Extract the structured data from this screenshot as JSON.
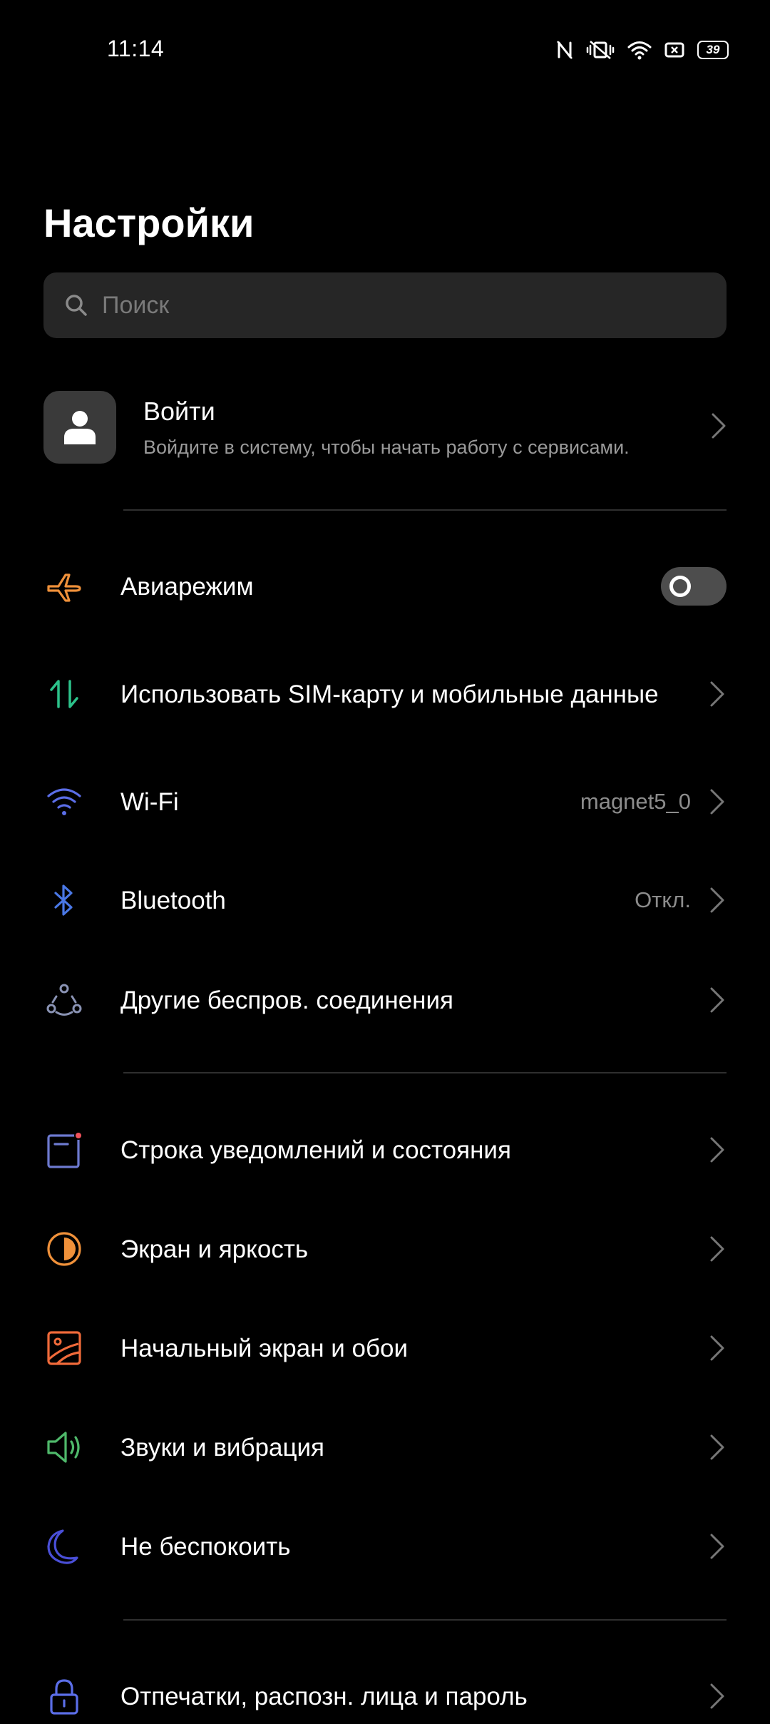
{
  "status_bar": {
    "time": "11:14",
    "battery": "39",
    "icons": [
      "nfc-icon",
      "vibrate-off-icon",
      "wifi-signal-icon",
      "sim-icon",
      "battery-icon"
    ]
  },
  "page": {
    "title": "Настройки"
  },
  "search": {
    "placeholder": "Поиск"
  },
  "account": {
    "title": "Войти",
    "subtitle": "Войдите в систему, чтобы начать работу с сервисами."
  },
  "settings": {
    "airplane": {
      "label": "Авиарежим",
      "icon": "airplane-icon",
      "enabled": false
    },
    "sim": {
      "label": "Использовать SIM-карту и мобильные данные",
      "icon": "mobile-data-icon"
    },
    "wifi": {
      "label": "Wi-Fi",
      "value": "magnet5_0",
      "icon": "wifi-icon"
    },
    "bluetooth": {
      "label": "Bluetooth",
      "value": "Откл.",
      "icon": "bluetooth-icon"
    },
    "other_wireless": {
      "label": "Другие беспров. соединения",
      "icon": "connections-icon"
    },
    "notifications": {
      "label": "Строка уведомлений и состояния",
      "icon": "notification-bar-icon"
    },
    "display": {
      "label": "Экран и яркость",
      "icon": "brightness-icon"
    },
    "home_screen": {
      "label": "Начальный экран и обои",
      "icon": "wallpaper-icon"
    },
    "sounds": {
      "label": "Звуки и вибрация",
      "icon": "speaker-icon"
    },
    "dnd": {
      "label": "Не беспокоить",
      "icon": "moon-icon"
    },
    "security": {
      "label": "Отпечатки, распозн. лица и пароль",
      "icon": "lock-icon"
    }
  },
  "colors": {
    "background": "#000000",
    "airplane": "#f0913a",
    "mobile_data_up": "#2cc28a",
    "wifi": "#5b6ee8",
    "bluetooth": "#4a78e6",
    "other_wireless": "#8a93b4",
    "notifications": "#6d7ad0",
    "notification_dot": "#f0525c",
    "display": "#f0913a",
    "home_screen": "#f06a3a",
    "sounds": "#4fb96b",
    "dnd": "#4a4fd8",
    "security": "#5b6ee8"
  }
}
